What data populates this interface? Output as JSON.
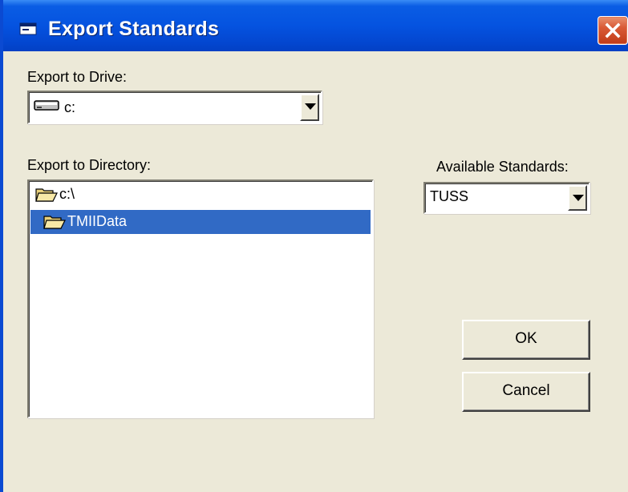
{
  "window": {
    "title": "Export Standards",
    "icon": "app-window-icon",
    "close_icon": "close-icon"
  },
  "drive": {
    "label": "Export to Drive:",
    "value": "c:",
    "icon": "drive-icon"
  },
  "directory": {
    "label": "Export to Directory:",
    "items": [
      {
        "label": "c:\\",
        "icon": "open-folder-icon",
        "selected": false
      },
      {
        "label": "TMIIData",
        "icon": "open-folder-icon",
        "selected": true
      }
    ]
  },
  "standards": {
    "label": "Available Standards:",
    "value": "TUSS"
  },
  "buttons": {
    "ok": "OK",
    "cancel": "Cancel"
  },
  "colors": {
    "titlebar": "#0553e0",
    "selection": "#316ac5",
    "face": "#ece9d8",
    "close": "#d95a36"
  }
}
